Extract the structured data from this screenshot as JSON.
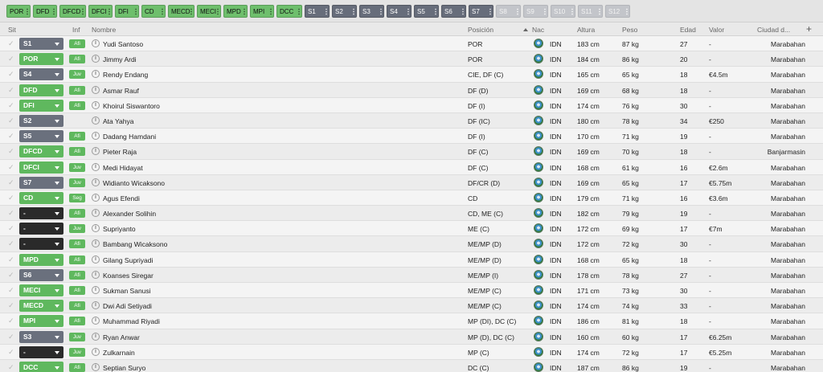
{
  "chips": [
    {
      "label": "POR",
      "style": "green"
    },
    {
      "label": "DFD",
      "style": "green"
    },
    {
      "label": "DFCD",
      "style": "green"
    },
    {
      "label": "DFCI",
      "style": "green"
    },
    {
      "label": "DFI",
      "style": "green"
    },
    {
      "label": "CD",
      "style": "green"
    },
    {
      "label": "MECD",
      "style": "green"
    },
    {
      "label": "MECI",
      "style": "green"
    },
    {
      "label": "MPD",
      "style": "green"
    },
    {
      "label": "MPI",
      "style": "green"
    },
    {
      "label": "DCC",
      "style": "green"
    },
    {
      "label": "S1",
      "style": "dark"
    },
    {
      "label": "S2",
      "style": "dark"
    },
    {
      "label": "S3",
      "style": "dark"
    },
    {
      "label": "S4",
      "style": "dark"
    },
    {
      "label": "S5",
      "style": "dark"
    },
    {
      "label": "S6",
      "style": "dark"
    },
    {
      "label": "S7",
      "style": "dark"
    },
    {
      "label": "S8",
      "style": "light"
    },
    {
      "label": "S9",
      "style": "light"
    },
    {
      "label": "S10",
      "style": "light"
    },
    {
      "label": "S11",
      "style": "light"
    },
    {
      "label": "S12",
      "style": "light"
    }
  ],
  "headers": {
    "sit": "Sit",
    "inf": "Inf",
    "nombre": "Nombre",
    "posicion": "Posición",
    "nac": "Nac",
    "altura": "Altura",
    "peso": "Peso",
    "edad": "Edad",
    "valor": "Valor",
    "ciudad": "Ciudad d...",
    "add": "+"
  },
  "rows": [
    {
      "sit": "S1",
      "sit_style": "grey",
      "inf": "Afi",
      "name": "Yudi Santoso",
      "pos": "POR",
      "nat": "IDN",
      "height": "183 cm",
      "weight": "87 kg",
      "age": "27",
      "value": "-",
      "city": "Marabahan"
    },
    {
      "sit": "POR",
      "sit_style": "green",
      "inf": "Afi",
      "name": "Jimmy Ardi",
      "pos": "POR",
      "nat": "IDN",
      "height": "184 cm",
      "weight": "86 kg",
      "age": "20",
      "value": "-",
      "city": "Marabahan"
    },
    {
      "sit": "S4",
      "sit_style": "grey",
      "inf": "Juv",
      "name": "Rendy Endang",
      "pos": "CIE, DF (C)",
      "nat": "IDN",
      "height": "165 cm",
      "weight": "65 kg",
      "age": "18",
      "value": "€4.5m",
      "city": "Marabahan"
    },
    {
      "sit": "DFD",
      "sit_style": "green",
      "inf": "Afi",
      "name": "Asmar Rauf",
      "pos": "DF (D)",
      "nat": "IDN",
      "height": "169 cm",
      "weight": "68 kg",
      "age": "18",
      "value": "-",
      "city": "Marabahan"
    },
    {
      "sit": "DFI",
      "sit_style": "green",
      "inf": "Afi",
      "name": "Khoirul Siswantoro",
      "pos": "DF (I)",
      "nat": "IDN",
      "height": "174 cm",
      "weight": "76 kg",
      "age": "30",
      "value": "-",
      "city": "Marabahan"
    },
    {
      "sit": "S2",
      "sit_style": "grey",
      "inf": "",
      "name": "Ata Yahya",
      "pos": "DF (IC)",
      "nat": "IDN",
      "height": "180 cm",
      "weight": "78 kg",
      "age": "34",
      "value": "€250",
      "city": "Marabahan"
    },
    {
      "sit": "S5",
      "sit_style": "grey",
      "inf": "Afi",
      "name": "Dadang Hamdani",
      "pos": "DF (I)",
      "nat": "IDN",
      "height": "170 cm",
      "weight": "71 kg",
      "age": "19",
      "value": "-",
      "city": "Marabahan"
    },
    {
      "sit": "DFCD",
      "sit_style": "green",
      "inf": "Afi",
      "name": "Pieter Raja",
      "pos": "DF (C)",
      "nat": "IDN",
      "height": "169 cm",
      "weight": "70 kg",
      "age": "18",
      "value": "-",
      "city": "Banjarmasin"
    },
    {
      "sit": "DFCI",
      "sit_style": "green",
      "inf": "Juv",
      "name": "Medi Hidayat",
      "pos": "DF (C)",
      "nat": "IDN",
      "height": "168 cm",
      "weight": "61 kg",
      "age": "16",
      "value": "€2.6m",
      "city": "Marabahan"
    },
    {
      "sit": "S7",
      "sit_style": "grey",
      "inf": "Juv",
      "name": "Widianto Wicaksono",
      "pos": "DF/CR (D)",
      "nat": "IDN",
      "height": "169 cm",
      "weight": "65 kg",
      "age": "17",
      "value": "€5.75m",
      "city": "Marabahan"
    },
    {
      "sit": "CD",
      "sit_style": "green",
      "inf": "Seg",
      "name": "Agus Efendi",
      "pos": "CD",
      "nat": "IDN",
      "height": "179 cm",
      "weight": "71 kg",
      "age": "16",
      "value": "€3.6m",
      "city": "Marabahan"
    },
    {
      "sit": "-",
      "sit_style": "black",
      "inf": "Afi",
      "name": "Alexander Solihin",
      "pos": "CD, ME (C)",
      "nat": "IDN",
      "height": "182 cm",
      "weight": "79 kg",
      "age": "19",
      "value": "-",
      "city": "Marabahan"
    },
    {
      "sit": "-",
      "sit_style": "black",
      "inf": "Juv",
      "name": "Supriyanto",
      "pos": "ME (C)",
      "nat": "IDN",
      "height": "172 cm",
      "weight": "69 kg",
      "age": "17",
      "value": "€7m",
      "city": "Marabahan"
    },
    {
      "sit": "-",
      "sit_style": "black",
      "inf": "Afi",
      "name": "Bambang Wicaksono",
      "pos": "ME/MP (D)",
      "nat": "IDN",
      "height": "172 cm",
      "weight": "72 kg",
      "age": "30",
      "value": "-",
      "city": "Marabahan"
    },
    {
      "sit": "MPD",
      "sit_style": "green",
      "inf": "Afi",
      "name": "Gilang Supriyadi",
      "pos": "ME/MP (D)",
      "nat": "IDN",
      "height": "168 cm",
      "weight": "65 kg",
      "age": "18",
      "value": "-",
      "city": "Marabahan"
    },
    {
      "sit": "S6",
      "sit_style": "grey",
      "inf": "Afi",
      "name": "Koanses Siregar",
      "pos": "ME/MP (I)",
      "nat": "IDN",
      "height": "178 cm",
      "weight": "78 kg",
      "age": "27",
      "value": "-",
      "city": "Marabahan"
    },
    {
      "sit": "MECI",
      "sit_style": "green",
      "inf": "Afi",
      "name": "Sukman Sanusi",
      "pos": "ME/MP (C)",
      "nat": "IDN",
      "height": "171 cm",
      "weight": "73 kg",
      "age": "30",
      "value": "-",
      "city": "Marabahan"
    },
    {
      "sit": "MECD",
      "sit_style": "green",
      "inf": "Afi",
      "name": "Dwi Adi Setiyadi",
      "pos": "ME/MP (C)",
      "nat": "IDN",
      "height": "174 cm",
      "weight": "74 kg",
      "age": "33",
      "value": "-",
      "city": "Marabahan"
    },
    {
      "sit": "MPI",
      "sit_style": "green",
      "inf": "Afi",
      "name": "Muhammad Riyadi",
      "pos": "MP (DI), DC (C)",
      "nat": "IDN",
      "height": "186 cm",
      "weight": "81 kg",
      "age": "18",
      "value": "-",
      "city": "Marabahan"
    },
    {
      "sit": "S3",
      "sit_style": "grey",
      "inf": "Juv",
      "name": "Ryan Anwar",
      "pos": "MP (D), DC (C)",
      "nat": "IDN",
      "height": "160 cm",
      "weight": "60 kg",
      "age": "17",
      "value": "€6.25m",
      "city": "Marabahan"
    },
    {
      "sit": "-",
      "sit_style": "black",
      "inf": "Juv",
      "name": "Zulkarnain",
      "pos": "MP (C)",
      "nat": "IDN",
      "height": "174 cm",
      "weight": "72 kg",
      "age": "17",
      "value": "€5.25m",
      "city": "Marabahan"
    },
    {
      "sit": "DCC",
      "sit_style": "green",
      "inf": "Afi",
      "name": "Septian Suryo",
      "pos": "DC (C)",
      "nat": "IDN",
      "height": "187 cm",
      "weight": "86 kg",
      "age": "19",
      "value": "-",
      "city": "Marabahan"
    }
  ]
}
